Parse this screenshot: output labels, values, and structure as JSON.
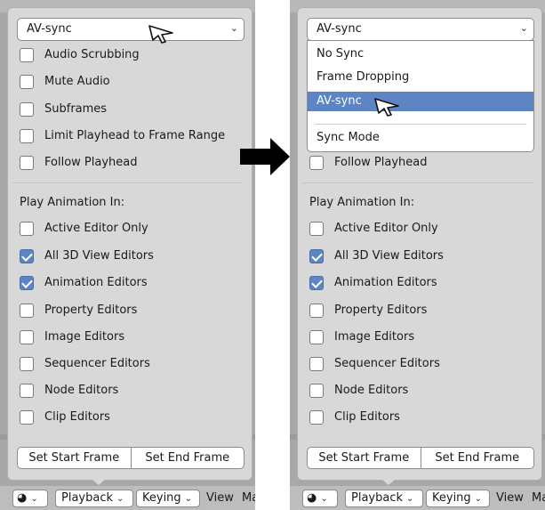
{
  "sync_options": [
    "No Sync",
    "Frame Dropping",
    "AV-sync",
    "Sync Mode"
  ],
  "sync_selected": "AV-sync",
  "checkboxes_top": [
    {
      "label": "Audio Scrubbing",
      "checked": false
    },
    {
      "label": "Mute Audio",
      "checked": false
    },
    {
      "label": "Subframes",
      "checked": false
    },
    {
      "label": "Limit Playhead to Frame Range",
      "checked": false
    },
    {
      "label": "Follow Playhead",
      "checked": false
    }
  ],
  "play_animation_label": "Play Animation In:",
  "checkboxes_play": [
    {
      "label": "Active Editor Only",
      "checked": false
    },
    {
      "label": "All 3D View Editors",
      "checked": true
    },
    {
      "label": "Animation Editors",
      "checked": true
    },
    {
      "label": "Property Editors",
      "checked": false
    },
    {
      "label": "Image Editors",
      "checked": false
    },
    {
      "label": "Sequencer Editors",
      "checked": false
    },
    {
      "label": "Node Editors",
      "checked": false
    },
    {
      "label": "Clip Editors",
      "checked": false
    }
  ],
  "frame_buttons": {
    "start": "Set Start Frame",
    "end": "Set End Frame"
  },
  "bottom_bar": {
    "playback": "Playback",
    "keying": "Keying",
    "view": "View",
    "marker": "Ma"
  },
  "icons": {
    "dropdown_chevron": "chevron-down-icon",
    "cursor": "mouse-pointer-icon",
    "arrow": "right-arrow-icon",
    "editor_type": "clock-icon"
  },
  "colors": {
    "accent": "#5d84c3",
    "panel": "#d8d8d8"
  }
}
